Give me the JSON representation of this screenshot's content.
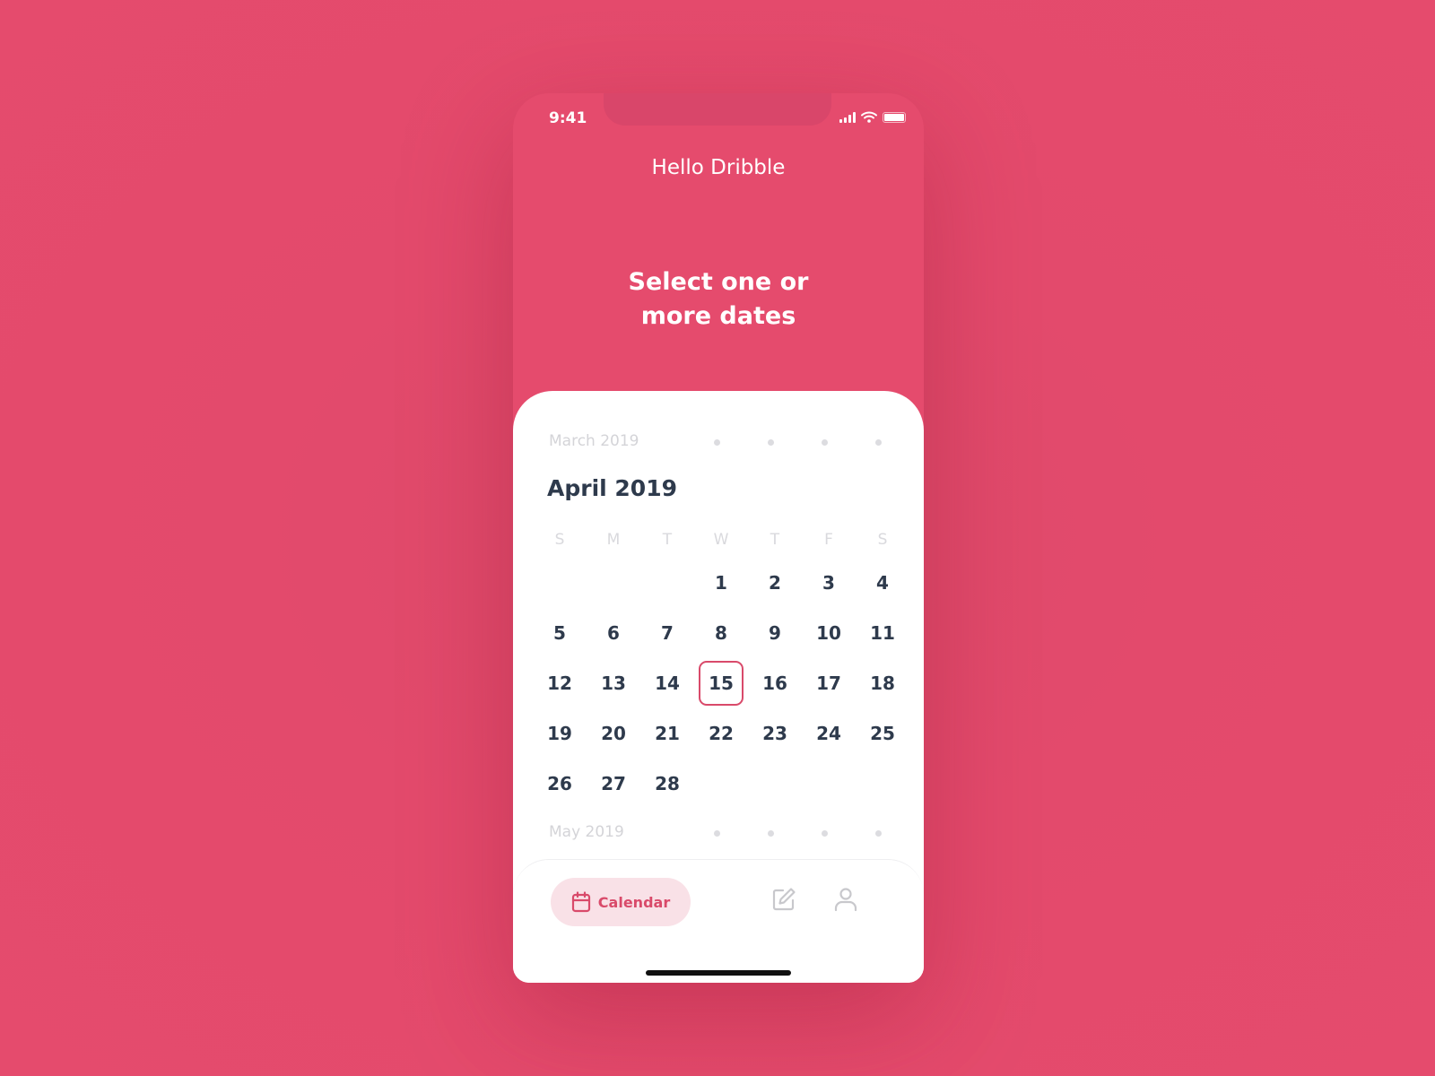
{
  "status_bar": {
    "time": "9:41"
  },
  "header": {
    "greeting": "Hello Dribble",
    "headline_line1": "Select one or",
    "headline_line2": "more dates"
  },
  "calendar": {
    "previous_month": "March 2019",
    "current_month": "April 2019",
    "next_month": "May 2019",
    "weekdays": [
      "S",
      "M",
      "T",
      "W",
      "T",
      "F",
      "S"
    ],
    "leading_blanks": 3,
    "days": [
      "1",
      "2",
      "3",
      "4",
      "5",
      "6",
      "7",
      "8",
      "9",
      "10",
      "11",
      "12",
      "13",
      "14",
      "15",
      "16",
      "17",
      "18",
      "19",
      "20",
      "21",
      "22",
      "23",
      "24",
      "25",
      "26",
      "27",
      "28"
    ],
    "selected_day": "15"
  },
  "tabbar": {
    "active_tab_label": "Calendar",
    "tabs": [
      {
        "id": "calendar",
        "icon": "calendar-icon"
      },
      {
        "id": "edit",
        "icon": "edit-icon"
      },
      {
        "id": "profile",
        "icon": "user-icon"
      }
    ]
  },
  "colors": {
    "accent": "#e54b6d",
    "selected_border": "#d94a6a",
    "text_dark": "#2e3a4c",
    "muted": "#d4d4d8",
    "active_tab_bg": "#f9e1e7"
  }
}
